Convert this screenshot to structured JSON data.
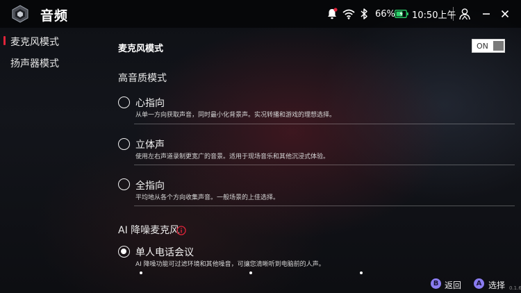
{
  "header": {
    "title": "音频",
    "battery": "66%",
    "time": "10:50上午",
    "icons": [
      "app-logo-icon",
      "notification-bell-icon",
      "wifi-icon",
      "bluetooth-icon",
      "battery-charging-icon",
      "user-profile-icon",
      "minimize-icon",
      "close-icon"
    ],
    "notification_dot_color": "#e0243a",
    "battery_color": "#29d36b"
  },
  "sidebar": {
    "items": [
      {
        "label": "麦克风模式",
        "active": true
      },
      {
        "label": "扬声器模式",
        "active": false
      }
    ],
    "active_marker_color": "#e0243a"
  },
  "main": {
    "mic_mode_label": "麦克风模式",
    "toggle_label": "ON",
    "hq_section": "高音质模式",
    "hq_options": [
      {
        "title": "心指向",
        "desc": "从单一方向获取声音，同时最小化背景声。实况转播和游戏的理想选择。",
        "selected": false
      },
      {
        "title": "立体声",
        "desc": "使用左右声道录制更宽广的音景。适用于现场音乐和其他沉浸式体验。",
        "selected": false
      },
      {
        "title": "全指向",
        "desc": "平均地从各个方向收集声音。一般场景的上佳选择。",
        "selected": false
      }
    ],
    "ai_section": "AI 降噪麦克风",
    "ai_options": [
      {
        "title": "单人电话会议",
        "desc": "AI 降噪功能可过滤环境和其他噪音，可讓您清晰听到电脑前的人声。",
        "selected": true
      }
    ]
  },
  "footer": {
    "back_label": "返回",
    "select_label": "选择",
    "back_key": "B",
    "select_key": "A",
    "button_color": "#8a7cf0",
    "corner_text": "0.1.6"
  }
}
